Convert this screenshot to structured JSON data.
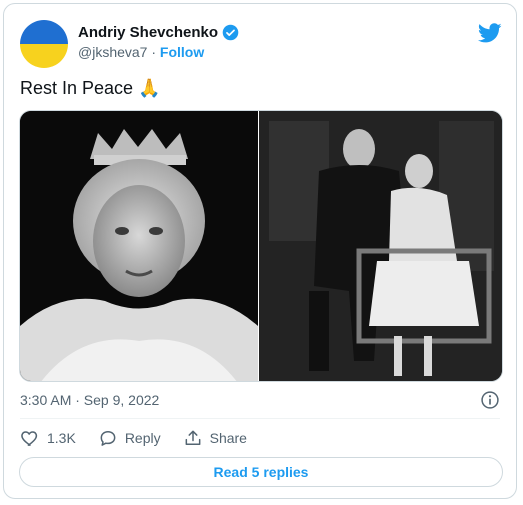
{
  "user": {
    "name": "Andriy Shevchenko",
    "handle": "@jksheva7",
    "separator": "·",
    "follow_label": "Follow"
  },
  "tweet": {
    "text": "Rest In Peace 🙏",
    "timestamp": "3:30 AM · Sep 9, 2022"
  },
  "actions": {
    "like_count": "1.3K",
    "reply_label": "Reply",
    "share_label": "Share"
  },
  "read_replies_label": "Read 5 replies",
  "colors": {
    "accent": "#1d9bf0",
    "flag_blue": "#1f6fd1",
    "flag_yellow": "#f7d21e"
  },
  "icons": [
    "verified-badge-icon",
    "twitter-bird-icon",
    "info-icon",
    "heart-icon",
    "reply-icon",
    "share-icon"
  ]
}
